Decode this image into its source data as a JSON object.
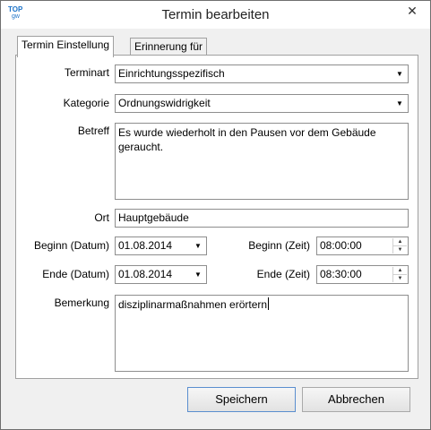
{
  "window": {
    "title": "Termin bearbeiten",
    "logo_top": "TOP",
    "logo_sub": "gw",
    "close_glyph": "✕"
  },
  "tabs": [
    {
      "label": "Termin Einstellung",
      "active": true
    },
    {
      "label": "Erinnerung für",
      "active": false
    }
  ],
  "form": {
    "terminart": {
      "label": "Terminart",
      "value": "Einrichtungsspezifisch"
    },
    "kategorie": {
      "label": "Kategorie",
      "value": "Ordnungswidrigkeit"
    },
    "betreff": {
      "label": "Betreff",
      "value": "Es wurde wiederholt in den Pausen vor dem Gebäude geraucht."
    },
    "ort": {
      "label": "Ort",
      "value": "Hauptgebäude"
    },
    "beginn_datum": {
      "label": "Beginn (Datum)",
      "value": "01.08.2014"
    },
    "ende_datum": {
      "label": "Ende (Datum)",
      "value": "01.08.2014"
    },
    "beginn_zeit": {
      "label": "Beginn (Zeit)",
      "value": "08:00:00"
    },
    "ende_zeit": {
      "label": "Ende (Zeit)",
      "value": "08:30:00"
    },
    "bemerkung": {
      "label": "Bemerkung",
      "value": "disziplinarmaßnahmen erörtern"
    }
  },
  "buttons": {
    "save": "Speichern",
    "cancel": "Abbrechen"
  },
  "icons": {
    "dropdown": "chevron-down-icon",
    "spin_up": "arrow-up-icon",
    "spin_down": "arrow-down-icon"
  },
  "colors": {
    "logo": "#1d73c8",
    "default_button_border": "#5a8ecf"
  }
}
